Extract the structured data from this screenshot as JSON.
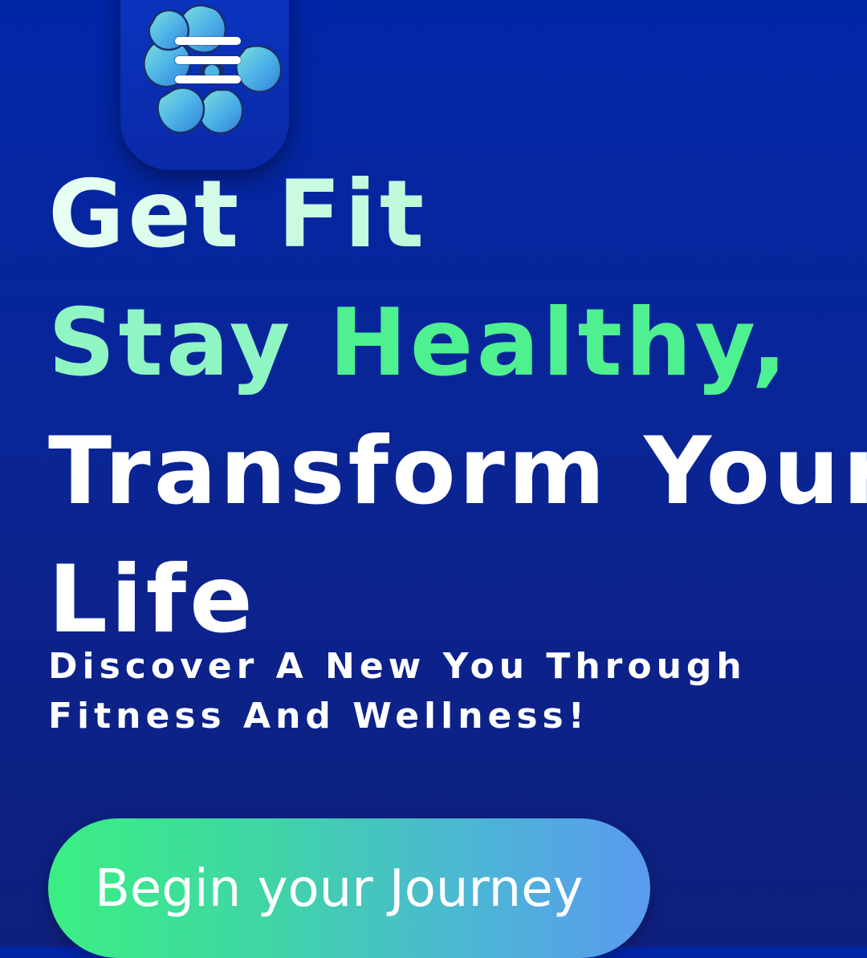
{
  "header": {
    "menu_icon": "hamburger-icon",
    "logo_icon": "flower-logo-icon"
  },
  "hero": {
    "line1": "Get Fit",
    "line2_part1": "Stay ",
    "line2_part2": "Healthy,",
    "line3": "Transform Your",
    "line4": "Life",
    "subtitle": "Discover A New You Through Fitness And Wellness!",
    "cta_label": "Begin your Journey"
  },
  "colors": {
    "background_top": "#0026a8",
    "background_bottom": "#0f1f7c",
    "accent_green": "#4ef08f",
    "accent_mint": "#8ff5c3",
    "cta_gradient_start": "#3bef82",
    "cta_gradient_end": "#5a9af0",
    "text": "#ffffff"
  }
}
